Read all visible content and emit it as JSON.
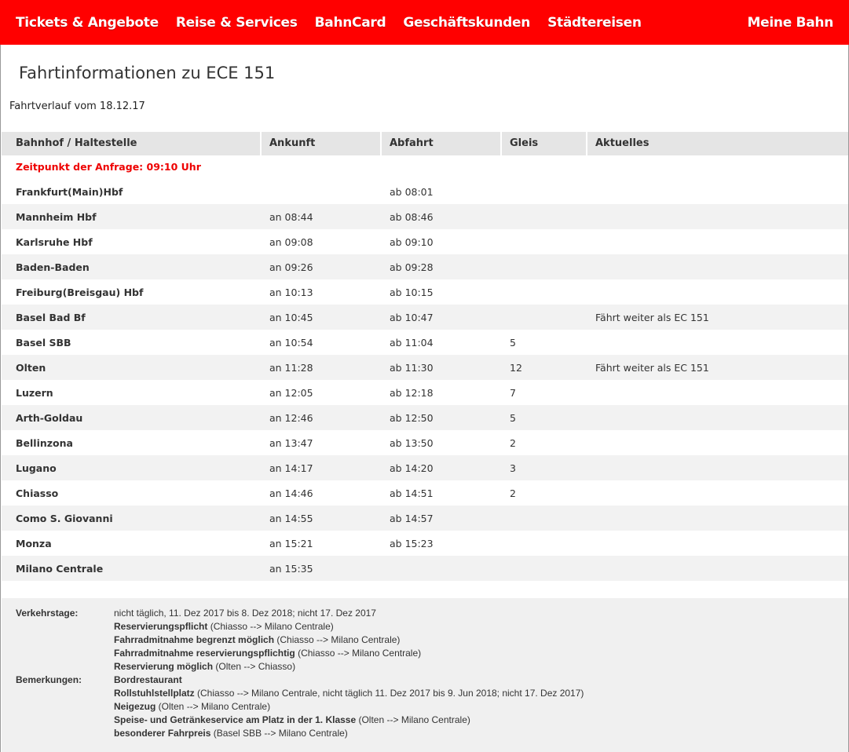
{
  "nav": {
    "items": [
      "Tickets & Angebote",
      "Reise & Services",
      "BahnCard",
      "Geschäftskunden",
      "Städtereisen"
    ],
    "right": "Meine Bahn"
  },
  "title": "Fahrtinformationen zu ECE 151",
  "subtitle": "Fahrtverlauf vom 18.12.17",
  "table": {
    "headers": [
      "Bahnhof / Haltestelle",
      "Ankunft",
      "Abfahrt",
      "Gleis",
      "Aktuelles"
    ],
    "query": "Zeitpunkt der Anfrage: 09:10 Uhr",
    "rows": [
      [
        "Frankfurt(Main)Hbf",
        "",
        "ab 08:01",
        "",
        ""
      ],
      [
        "Mannheim Hbf",
        "an 08:44",
        "ab 08:46",
        "",
        ""
      ],
      [
        "Karlsruhe Hbf",
        "an 09:08",
        "ab 09:10",
        "",
        ""
      ],
      [
        "Baden-Baden",
        "an 09:26",
        "ab 09:28",
        "",
        ""
      ],
      [
        "Freiburg(Breisgau) Hbf",
        "an 10:13",
        "ab 10:15",
        "",
        ""
      ],
      [
        "Basel Bad Bf",
        "an 10:45",
        "ab 10:47",
        "",
        "Fährt weiter als EC 151"
      ],
      [
        "Basel SBB",
        "an 10:54",
        "ab 11:04",
        "5",
        ""
      ],
      [
        "Olten",
        "an 11:28",
        "ab 11:30",
        "12",
        "Fährt weiter als EC 151"
      ],
      [
        "Luzern",
        "an 12:05",
        "ab 12:18",
        "7",
        ""
      ],
      [
        "Arth-Goldau",
        "an 12:46",
        "ab 12:50",
        "5",
        ""
      ],
      [
        "Bellinzona",
        "an 13:47",
        "ab 13:50",
        "2",
        ""
      ],
      [
        "Lugano",
        "an 14:17",
        "ab 14:20",
        "3",
        ""
      ],
      [
        "Chiasso",
        "an 14:46",
        "ab 14:51",
        "2",
        ""
      ],
      [
        "Como S. Giovanni",
        "an 14:55",
        "ab 14:57",
        "",
        ""
      ],
      [
        "Monza",
        "an 15:21",
        "ab 15:23",
        "",
        ""
      ],
      [
        "Milano Centrale",
        "an 15:35",
        "",
        "",
        ""
      ]
    ]
  },
  "footer": {
    "verkehrstage_label": "Verkehrstage:",
    "bemerkungen_label": "Bemerkungen:",
    "lines": [
      [
        "",
        "nicht täglich, 11. Dez 2017 bis 8. Dez 2018; nicht 17. Dez 2017"
      ],
      [
        "Reservierungspflicht",
        " (Chiasso --> Milano Centrale)"
      ],
      [
        "Fahrradmitnahme begrenzt möglich",
        " (Chiasso --> Milano Centrale)"
      ],
      [
        "Fahrradmitnahme reservierungspflichtig",
        " (Chiasso --> Milano Centrale)"
      ],
      [
        "Reservierung möglich",
        " (Olten --> Chiasso)"
      ],
      [
        "Bordrestaurant",
        ""
      ],
      [
        "Rollstuhlstellplatz",
        " (Chiasso --> Milano Centrale, nicht täglich 11. Dez 2017 bis 9. Jun 2018; nicht 17. Dez 2017)"
      ],
      [
        "Neigezug",
        " (Olten --> Milano Centrale)"
      ],
      [
        "Speise- und Getränkeservice am Platz in der 1. Klasse",
        " (Olten --> Milano Centrale)"
      ],
      [
        "besonderer Fahrpreis",
        " (Basel SBB --> Milano Centrale)"
      ]
    ]
  }
}
